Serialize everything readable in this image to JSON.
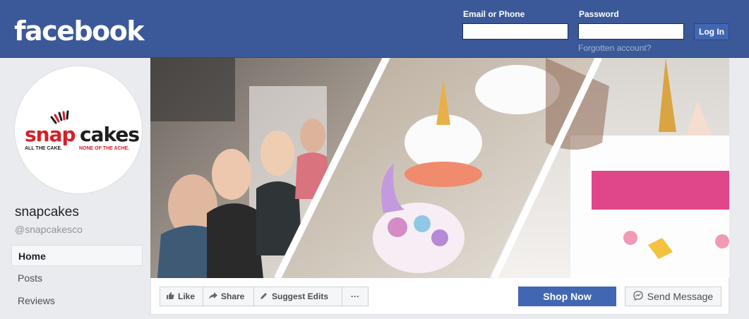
{
  "header": {
    "logo": "facebook",
    "email_label": "Email or Phone",
    "password_label": "Password",
    "login_button": "Log In",
    "forgot_link": "Forgotten account?",
    "email_value": "",
    "password_value": ""
  },
  "profile": {
    "logo_text_snap": "snap",
    "logo_text_cakes": "cakes",
    "tagline_left": "ALL THE CAKE.",
    "tagline_right": "NONE OF THE ACHE.",
    "name": "snapcakes",
    "handle": "@snapcakesco"
  },
  "nav": {
    "items": [
      {
        "label": "Home",
        "active": true
      },
      {
        "label": "Posts",
        "active": false
      },
      {
        "label": "Reviews",
        "active": false
      }
    ]
  },
  "actions": {
    "like": "Like",
    "share": "Share",
    "suggest": "Suggest Edits",
    "more": "···",
    "shop_now": "Shop Now",
    "send_message": "Send Message"
  },
  "colors": {
    "brand_blue": "#3b5998",
    "button_blue": "#4267b2",
    "snap_red": "#d71f26"
  },
  "icons": {
    "like": "thumbs-up-icon",
    "share": "share-arrow-icon",
    "suggest": "pencil-icon",
    "more": "more-dots-icon",
    "messenger": "messenger-icon"
  }
}
